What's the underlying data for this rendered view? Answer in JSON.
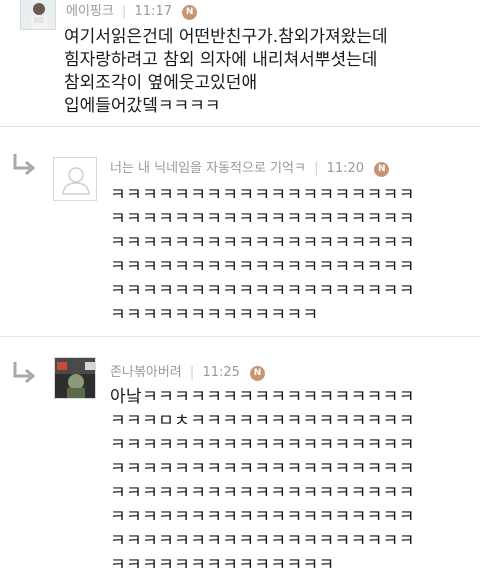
{
  "comments": [
    {
      "username": "에이핑크",
      "time": "11:17",
      "badge": "N",
      "lines": [
        "여기서읽은건데 어떤반친구가.참외가져왔는데",
        "힘자랑하려고 참외 의자에 내리쳐서뿌셧는데",
        "참외조각이 옆에웃고있던애",
        "입에들어갔뎈ㅋㅋㅋㅋ"
      ]
    },
    {
      "username": "너는 내 닉네임을 자동적으로 기억ㅋ",
      "time": "11:20",
      "badge": "N",
      "lines": [
        "ㅋㅋㅋㅋㅋㅋㅋㅋㅋㅋㅋㅋㅋㅋㅋㅋㅋㅋㅋ",
        "ㅋㅋㅋㅋㅋㅋㅋㅋㅋㅋㅋㅋㅋㅋㅋㅋㅋㅋㅋ",
        "ㅋㅋㅋㅋㅋㅋㅋㅋㅋㅋㅋㅋㅋㅋㅋㅋㅋㅋㅋ",
        "ㅋㅋㅋㅋㅋㅋㅋㅋㅋㅋㅋㅋㅋㅋㅋㅋㅋㅋㅋ",
        "ㅋㅋㅋㅋㅋㅋㅋㅋㅋㅋㅋㅋㅋㅋㅋㅋㅋㅋㅋ",
        "ㅋㅋㅋㅋㅋㅋㅋㅋㅋㅋㅋㅋㅋ"
      ]
    },
    {
      "username": "존나볶아버려",
      "time": "11:25",
      "badge": "N",
      "lines": [
        "아낰ㅋㅋㅋㅋㅋㅋㅋㅋㅋㅋㅋㅋㅋㅋㅋㅋㅋ",
        "ㅋㅋㅋㅁㅊㅋㅋㅋㅋㅋㅋㅋㅋㅋㅋㅋㅋㅋㅋ",
        "ㅋㅋㅋㅋㅋㅋㅋㅋㅋㅋㅋㅋㅋㅋㅋㅋㅋㅋㅋ",
        "ㅋㅋㅋㅋㅋㅋㅋㅋㅋㅋㅋㅋㅋㅋㅋㅋㅋㅋㅋ",
        "ㅋㅋㅋㅋㅋㅋㅋㅋㅋㅋㅋㅋㅋㅋㅋㅋㅋㅋㅋ",
        "ㅋㅋㅋㅋㅋㅋㅋㅋㅋㅋㅋㅋㅋㅋㅋㅋㅋㅋㅋ",
        "ㅋㅋㅋㅋㅋㅋㅋㅋㅋㅋㅋㅋㅋㅋㅋㅋㅋㅋㅋ",
        "ㅋㅋㅋㅋㅋㅋㅋㅋㅋㅋㅋㅋㅋㅋ"
      ]
    }
  ],
  "icons": {
    "reply": "reply-arrow-icon",
    "default_avatar": "user-silhouette-icon"
  },
  "colors": {
    "badge": "#c89572",
    "meta_text": "#9a9a9a",
    "divider": "#e3e3e3"
  }
}
